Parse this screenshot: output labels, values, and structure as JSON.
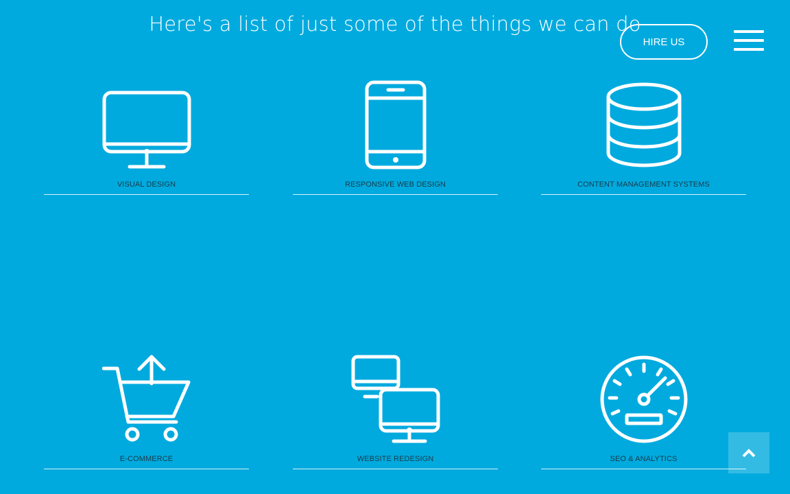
{
  "header": {
    "headline": "Here's a list of just some of the things we can do",
    "hire_label": "HIRE US",
    "menu_icon": "hamburger-menu-icon"
  },
  "services": [
    {
      "label": "VISUAL DESIGN",
      "icon": "desktop-monitor-icon"
    },
    {
      "label": "RESPONSIVE WEB DESIGN",
      "icon": "smartphone-icon"
    },
    {
      "label": "CONTENT MANAGEMENT SYSTEMS",
      "icon": "database-icon"
    },
    {
      "label": "E-COMMERCE",
      "icon": "shopping-cart-icon"
    },
    {
      "label": "WEBSITE REDESIGN",
      "icon": "two-monitors-icon"
    },
    {
      "label": "SEO & ANALYTICS",
      "icon": "speedometer-icon"
    }
  ],
  "scroll_to_top_icon": "chevron-up-icon",
  "colors": {
    "background": "#00aade",
    "foreground": "#ffffff",
    "label_text": "#1a3b4a"
  }
}
